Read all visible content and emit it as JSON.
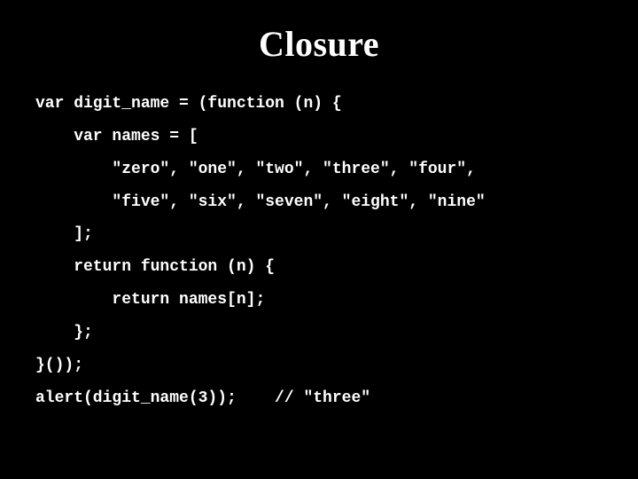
{
  "title": "Closure",
  "code": {
    "l1": "var digit_name = (function (n) {",
    "l2": "    var names = [",
    "l3": "        \"zero\", \"one\", \"two\", \"three\", \"four\",",
    "l4": "        \"five\", \"six\", \"seven\", \"eight\", \"nine\"",
    "l5": "    ];",
    "l6": "",
    "l7": "    return function (n) {",
    "l8": "        return names[n];",
    "l9": "    };",
    "l10": "}());",
    "l11": "",
    "l12": "alert(digit_name(3));    // \"three\""
  }
}
